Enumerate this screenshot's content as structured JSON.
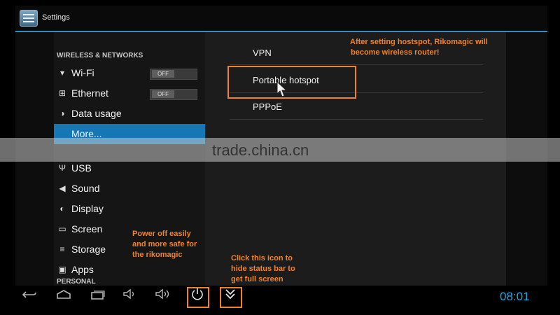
{
  "app": {
    "title": "Settings"
  },
  "sections": {
    "wireless": "WIRELESS & NETWORKS",
    "personal": "PERSONAL"
  },
  "settings_list": [
    {
      "label": "Wi-Fi",
      "toggle": "OFF"
    },
    {
      "label": "Ethernet",
      "toggle": "OFF"
    },
    {
      "label": "Data usage"
    },
    {
      "label": "More..."
    },
    {
      "label": "USB"
    },
    {
      "label": "Sound"
    },
    {
      "label": "Display"
    },
    {
      "label": "Screen"
    },
    {
      "label": "Storage"
    },
    {
      "label": "Apps"
    }
  ],
  "more_panel": {
    "items": [
      "VPN",
      "Portable hotspot",
      "PPPoE"
    ]
  },
  "annotations": {
    "hotspot_note_1": "After setting hostspot, Rikomagic will",
    "hotspot_note_2": "become wireless router!",
    "power_note_1": "Power off easily",
    "power_note_2": "and more safe for",
    "power_note_3": "the rikomagic",
    "statusbar_note_1": "Click this icon to",
    "statusbar_note_2": "hide status bar to",
    "statusbar_note_3": "get full screen"
  },
  "watermark": "trade.china.cn",
  "navbar": {
    "icons": [
      "back-icon",
      "home-icon",
      "recent-apps-icon",
      "volume-down-icon",
      "volume-up-icon",
      "power-icon",
      "hide-statusbar-icon"
    ],
    "clock": "08:01"
  },
  "colors": {
    "accent": "#1578b4",
    "annotation": "#f0822d",
    "clock": "#2aa7e8"
  }
}
